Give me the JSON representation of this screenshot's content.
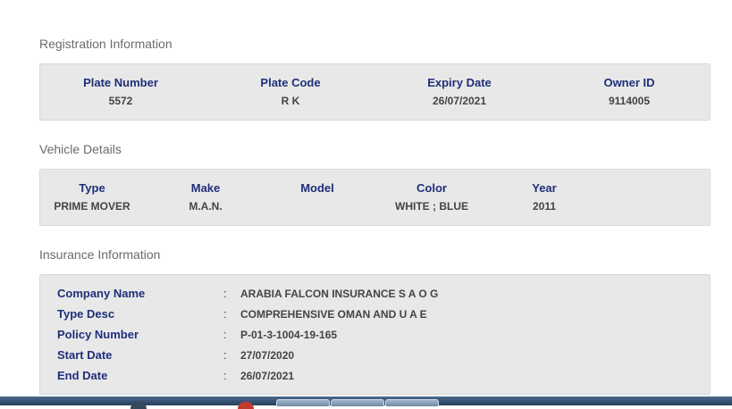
{
  "registration": {
    "title": "Registration Information",
    "fields": [
      {
        "label": "Plate Number",
        "value": "5572"
      },
      {
        "label": "Plate Code",
        "value": "R K"
      },
      {
        "label": "Expiry Date",
        "value": "26/07/2021"
      },
      {
        "label": "Owner ID",
        "value": "9114005"
      }
    ]
  },
  "vehicle": {
    "title": "Vehicle Details",
    "fields": [
      {
        "label": "Type",
        "value": "PRIME MOVER"
      },
      {
        "label": "Make",
        "value": "M.A.N."
      },
      {
        "label": "Model",
        "value": ""
      },
      {
        "label": "Color",
        "value": "WHITE ; BLUE"
      },
      {
        "label": "Year",
        "value": "2011"
      }
    ]
  },
  "insurance": {
    "title": "Insurance Information",
    "separator": ":",
    "rows": [
      {
        "label": "Company Name",
        "value": "ARABIA FALCON INSURANCE S A O G"
      },
      {
        "label": "Type Desc",
        "value": "COMPREHENSIVE OMAN AND U A E"
      },
      {
        "label": "Policy Number",
        "value": "P-01-3-1004-19-165"
      },
      {
        "label": "Start Date",
        "value": "27/07/2020"
      },
      {
        "label": "End Date",
        "value": "26/07/2021"
      }
    ]
  }
}
